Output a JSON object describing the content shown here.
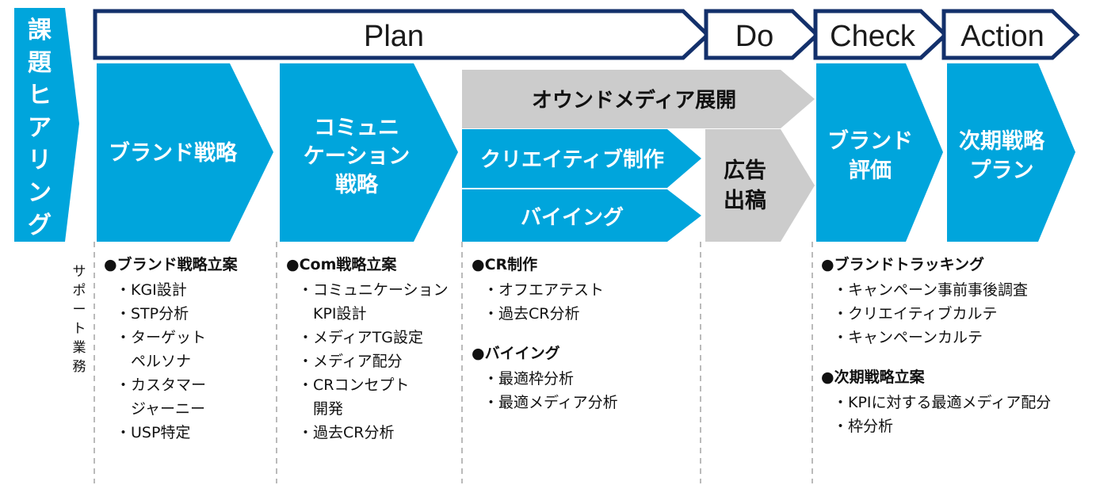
{
  "colors": {
    "blue": "#00A5DC",
    "gray": "#CCCCCC",
    "navy": "#13306B",
    "text_dark": "#111111",
    "text_white": "#FFFFFF",
    "divider": "#AAAAAA",
    "background": "#FFFFFF"
  },
  "entry": {
    "label_chars": [
      "課",
      "題",
      "ヒ",
      "ア",
      "リ",
      "ン",
      "グ"
    ],
    "label": "課題ヒアリング"
  },
  "pdca_header": [
    {
      "label": "Plan"
    },
    {
      "label": "Do"
    },
    {
      "label": "Check"
    },
    {
      "label": "Action"
    }
  ],
  "stages": [
    {
      "name": "brand-strategy",
      "lines": [
        "ブランド戦略"
      ],
      "fill": "blue"
    },
    {
      "name": "communication-strategy",
      "lines": [
        "コミュニ",
        "ケーション",
        "戦略"
      ],
      "fill": "blue"
    },
    {
      "name": "brand-evaluation",
      "lines": [
        "ブランド",
        "評価"
      ],
      "fill": "blue"
    },
    {
      "name": "next-strategy-plan",
      "lines": [
        "次期戦略",
        "プラン"
      ],
      "fill": "blue"
    }
  ],
  "bands": [
    {
      "name": "owned-media",
      "label": "オウンドメディア展開",
      "fill": "gray"
    },
    {
      "name": "creative-production",
      "label": "クリエイティブ制作",
      "fill": "blue"
    },
    {
      "name": "buying",
      "label": "バイイング",
      "fill": "blue"
    }
  ],
  "ad_delivery": {
    "name": "ad-delivery",
    "lines": [
      "広告",
      "出稿"
    ],
    "fill": "gray"
  },
  "support_label": {
    "label": "サポート業務",
    "chars": [
      "サ",
      "ポ",
      "ー",
      "ト",
      "業",
      "務"
    ]
  },
  "detail_columns": [
    {
      "name": "brand-strategy-details",
      "groups": [
        {
          "heading": "●ブランド戦略立案",
          "items": [
            "・KGI設計",
            "・STP分析",
            "・ターゲット",
            "　ペルソナ",
            "・カスタマー",
            "　ジャーニー",
            "・USP特定"
          ]
        }
      ]
    },
    {
      "name": "communication-strategy-details",
      "groups": [
        {
          "heading": "●Com戦略立案",
          "items": [
            "・コミュニケーション",
            "　KPI設計",
            "・メディアTG設定",
            "・メディア配分",
            "・CRコンセプト",
            "　開発",
            "・過去CR分析"
          ]
        }
      ]
    },
    {
      "name": "creative-buying-details",
      "groups": [
        {
          "heading": "●CR制作",
          "items": [
            "・オフエアテスト",
            "・過去CR分析"
          ]
        },
        {
          "heading": "●バイイング",
          "items": [
            "・最適枠分析",
            "・最適メディア分析"
          ]
        }
      ]
    },
    {
      "name": "evaluation-next-plan-details",
      "groups": [
        {
          "heading": "●ブランドトラッキング",
          "items": [
            "・キャンペーン事前事後調査",
            "・クリエイティブカルテ",
            "・キャンペーンカルテ"
          ]
        },
        {
          "heading": "●次期戦略立案",
          "items": [
            "・KPIに対する最適メディア配分",
            "・枠分析"
          ]
        }
      ]
    }
  ]
}
